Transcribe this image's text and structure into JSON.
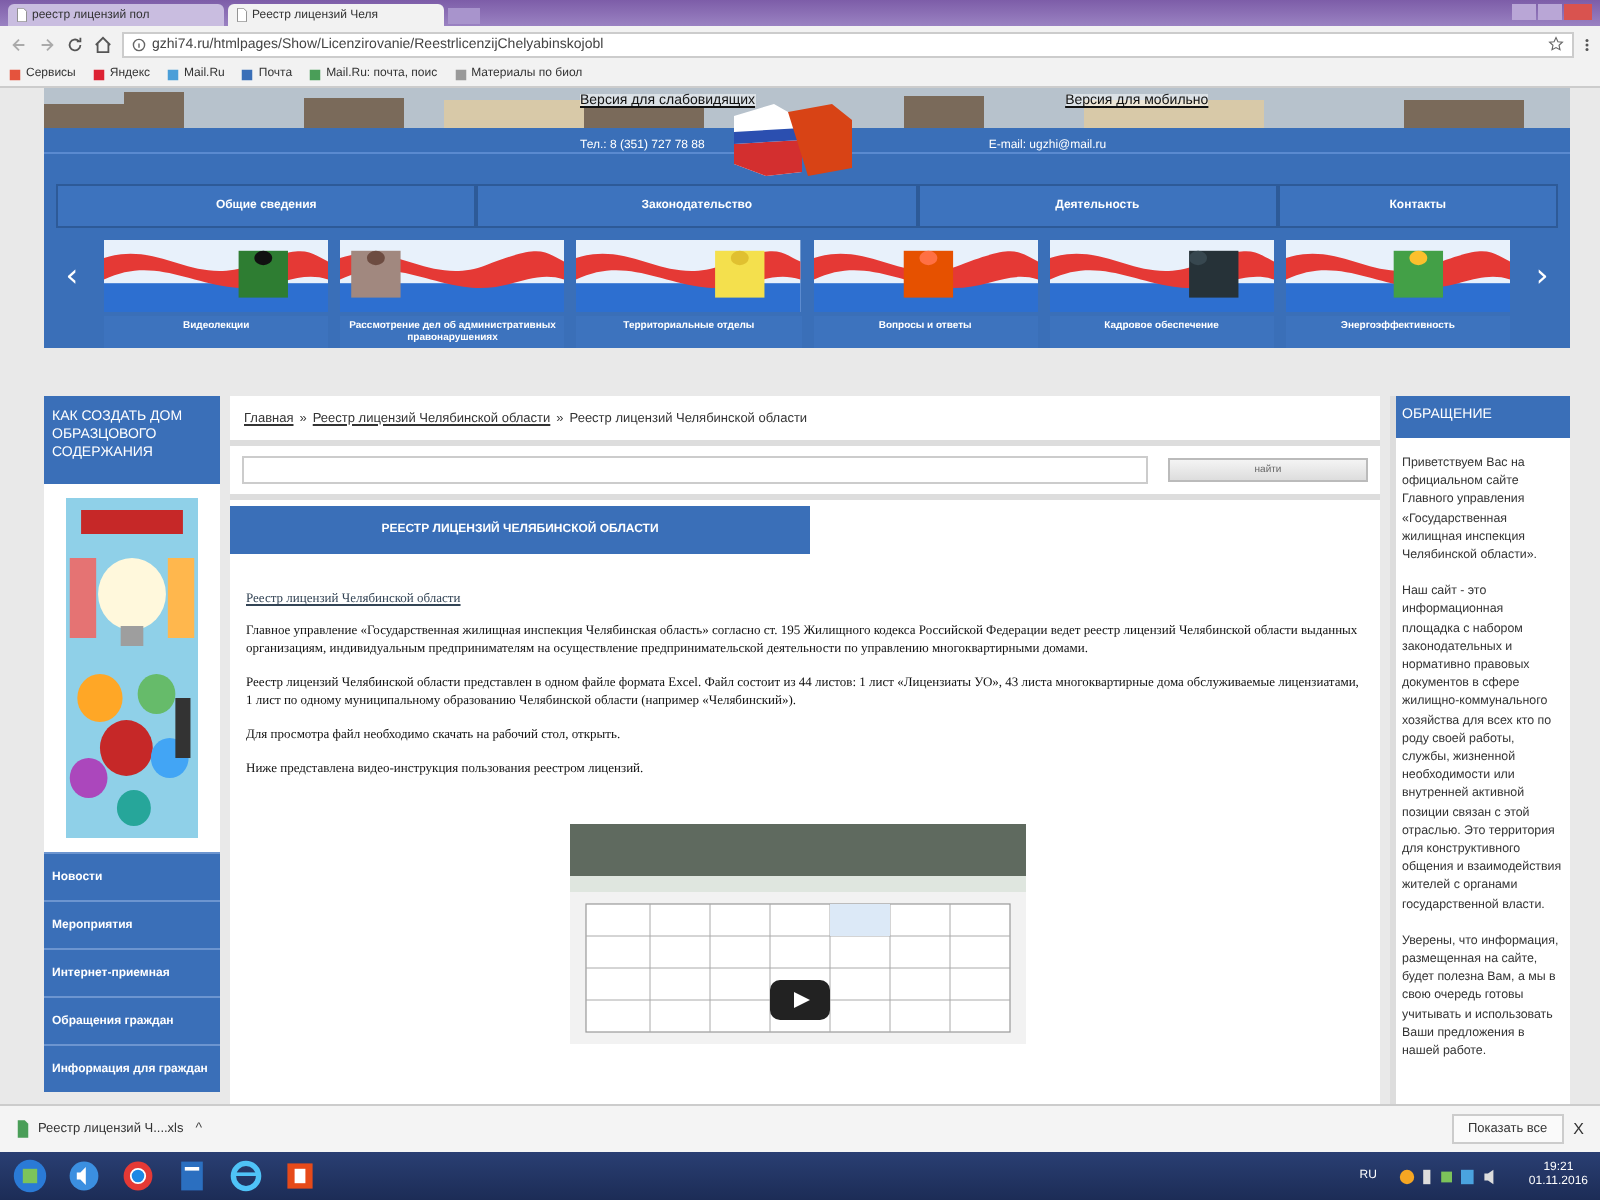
{
  "browser": {
    "tabs": [
      {
        "title": "реестр лицензий пол",
        "selected": false
      },
      {
        "title": "Реестр лицензий Челя",
        "selected": true
      }
    ],
    "url": "gzhi74.ru/htmlpages/Show/Licenzirovanie/ReestrlicenzijChelyabinskojobl",
    "bookmarks": [
      "Сервисы",
      "Яндекс",
      "Mail.Ru",
      "Почта",
      "Mail.Ru: почта, поис",
      "Материалы по биол"
    ]
  },
  "site_header": {
    "accessibility_link": "Версия для слабовидящих",
    "mobile_link": "Версия для мобильно",
    "phone": "Тел.: 8 (351) 727 78 88",
    "email": "E-mail: ugzhi@mail.ru"
  },
  "nav": [
    "Общие сведения",
    "Законодательство",
    "Деятельность",
    "Контакты"
  ],
  "carousel": {
    "prev": "‹",
    "next": "›",
    "items": [
      {
        "caption": "Видеолекции"
      },
      {
        "caption": "Рассмотрение дел об административных правонарушениях"
      },
      {
        "caption": "Территориальные отделы"
      },
      {
        "caption": "Вопросы и ответы"
      },
      {
        "caption": "Кадровое обеспечение"
      },
      {
        "caption": "Энергоэффективность"
      }
    ]
  },
  "left_sidebar": {
    "banner": "КАК СОЗДАТЬ ДОМ ОБРАЗЦОВОГО СОДЕРЖАНИЯ",
    "menu": [
      "Новости",
      "Мероприятия",
      "Интернет-приемная",
      "Обращения граждан",
      "Информация для граждан"
    ]
  },
  "breadcrumb": [
    {
      "kind": "link",
      "text": "Главная"
    },
    {
      "kind": "separator",
      "text": "»"
    },
    {
      "kind": "link",
      "text": "Реестр лицензий Челябинской области"
    },
    {
      "kind": "separator",
      "text": "»"
    },
    {
      "kind": "current",
      "text": "Реестр лицензий Челябинской области"
    }
  ],
  "search": {
    "button": "найти"
  },
  "main": {
    "title": "РЕЕСТР ЛИЦЕНЗИЙ ЧЕЛЯБИНСКОЙ ОБЛАСТИ",
    "link": "Реестр лицензий Челябинской области",
    "paragraphs": [
      "Главное управление «Государственная жилищная инспекция Челябинская область» согласно ст. 195 Жилищного кодекса Российской Федерации ведет реестр лицензий Челябинской области выданных организациям, индивидуальным предпринимателям на осуществление предпринимательской деятельности по управлению многоквартирными домами.",
      "Реестр лицензий Челябинской области представлен в одном файле формата Excel. Файл состоит из 44 листов: 1 лист «Лицензиаты УО», 43 листа многоквартирные дома обслуживаемые лицензиатами, 1 лист по одному муниципальному образованию Челябинской области (например «Челябинский»).",
      "Для просмотра файл необходимо скачать на рабочий стол, открыть.",
      "Ниже представлена видео-инструкция пользования реестром лицензий."
    ]
  },
  "right_sidebar": {
    "title": "ОБРАЩЕНИЕ",
    "paragraphs": [
      "Приветствуем Вас на официальном сайте Главного управления «Государственная жилищная инспекция Челябинской области».",
      "Наш сайт - это информационная площадка с набором законодательных и нормативно правовых документов в сфере жилищно-коммунального хозяйства для всех кто по роду своей работы, службы, жизненной необходимости или внутренней активной позиции связан с этой отраслью. Это территория для конструктивного общения и взаимодействия жителей с органами государственной власти.",
      "Уверены, что информация, размещенная на сайте, будет полезна Вам, а мы в свою очередь готовы учитывать и использовать Ваши предложения в нашей работе."
    ]
  },
  "download_bar": {
    "file": "Реестр лицензий Ч....xls",
    "caret": "^",
    "show_all": "Показать все",
    "close": "X"
  },
  "taskbar": {
    "language": "RU",
    "time": "19:21",
    "date": "01.11.2016"
  }
}
